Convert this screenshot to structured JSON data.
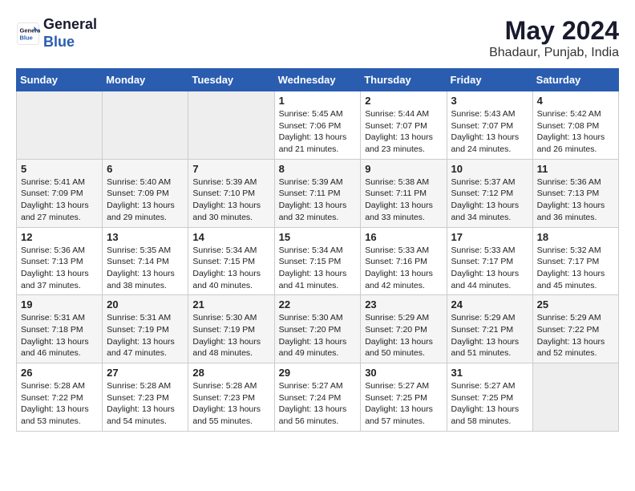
{
  "header": {
    "logo_line1": "General",
    "logo_line2": "Blue",
    "month": "May 2024",
    "location": "Bhadaur, Punjab, India"
  },
  "days_of_week": [
    "Sunday",
    "Monday",
    "Tuesday",
    "Wednesday",
    "Thursday",
    "Friday",
    "Saturday"
  ],
  "weeks": [
    [
      {
        "day": "",
        "info": ""
      },
      {
        "day": "",
        "info": ""
      },
      {
        "day": "",
        "info": ""
      },
      {
        "day": "1",
        "info": "Sunrise: 5:45 AM\nSunset: 7:06 PM\nDaylight: 13 hours\nand 21 minutes."
      },
      {
        "day": "2",
        "info": "Sunrise: 5:44 AM\nSunset: 7:07 PM\nDaylight: 13 hours\nand 23 minutes."
      },
      {
        "day": "3",
        "info": "Sunrise: 5:43 AM\nSunset: 7:07 PM\nDaylight: 13 hours\nand 24 minutes."
      },
      {
        "day": "4",
        "info": "Sunrise: 5:42 AM\nSunset: 7:08 PM\nDaylight: 13 hours\nand 26 minutes."
      }
    ],
    [
      {
        "day": "5",
        "info": "Sunrise: 5:41 AM\nSunset: 7:09 PM\nDaylight: 13 hours\nand 27 minutes."
      },
      {
        "day": "6",
        "info": "Sunrise: 5:40 AM\nSunset: 7:09 PM\nDaylight: 13 hours\nand 29 minutes."
      },
      {
        "day": "7",
        "info": "Sunrise: 5:39 AM\nSunset: 7:10 PM\nDaylight: 13 hours\nand 30 minutes."
      },
      {
        "day": "8",
        "info": "Sunrise: 5:39 AM\nSunset: 7:11 PM\nDaylight: 13 hours\nand 32 minutes."
      },
      {
        "day": "9",
        "info": "Sunrise: 5:38 AM\nSunset: 7:11 PM\nDaylight: 13 hours\nand 33 minutes."
      },
      {
        "day": "10",
        "info": "Sunrise: 5:37 AM\nSunset: 7:12 PM\nDaylight: 13 hours\nand 34 minutes."
      },
      {
        "day": "11",
        "info": "Sunrise: 5:36 AM\nSunset: 7:13 PM\nDaylight: 13 hours\nand 36 minutes."
      }
    ],
    [
      {
        "day": "12",
        "info": "Sunrise: 5:36 AM\nSunset: 7:13 PM\nDaylight: 13 hours\nand 37 minutes."
      },
      {
        "day": "13",
        "info": "Sunrise: 5:35 AM\nSunset: 7:14 PM\nDaylight: 13 hours\nand 38 minutes."
      },
      {
        "day": "14",
        "info": "Sunrise: 5:34 AM\nSunset: 7:15 PM\nDaylight: 13 hours\nand 40 minutes."
      },
      {
        "day": "15",
        "info": "Sunrise: 5:34 AM\nSunset: 7:15 PM\nDaylight: 13 hours\nand 41 minutes."
      },
      {
        "day": "16",
        "info": "Sunrise: 5:33 AM\nSunset: 7:16 PM\nDaylight: 13 hours\nand 42 minutes."
      },
      {
        "day": "17",
        "info": "Sunrise: 5:33 AM\nSunset: 7:17 PM\nDaylight: 13 hours\nand 44 minutes."
      },
      {
        "day": "18",
        "info": "Sunrise: 5:32 AM\nSunset: 7:17 PM\nDaylight: 13 hours\nand 45 minutes."
      }
    ],
    [
      {
        "day": "19",
        "info": "Sunrise: 5:31 AM\nSunset: 7:18 PM\nDaylight: 13 hours\nand 46 minutes."
      },
      {
        "day": "20",
        "info": "Sunrise: 5:31 AM\nSunset: 7:19 PM\nDaylight: 13 hours\nand 47 minutes."
      },
      {
        "day": "21",
        "info": "Sunrise: 5:30 AM\nSunset: 7:19 PM\nDaylight: 13 hours\nand 48 minutes."
      },
      {
        "day": "22",
        "info": "Sunrise: 5:30 AM\nSunset: 7:20 PM\nDaylight: 13 hours\nand 49 minutes."
      },
      {
        "day": "23",
        "info": "Sunrise: 5:29 AM\nSunset: 7:20 PM\nDaylight: 13 hours\nand 50 minutes."
      },
      {
        "day": "24",
        "info": "Sunrise: 5:29 AM\nSunset: 7:21 PM\nDaylight: 13 hours\nand 51 minutes."
      },
      {
        "day": "25",
        "info": "Sunrise: 5:29 AM\nSunset: 7:22 PM\nDaylight: 13 hours\nand 52 minutes."
      }
    ],
    [
      {
        "day": "26",
        "info": "Sunrise: 5:28 AM\nSunset: 7:22 PM\nDaylight: 13 hours\nand 53 minutes."
      },
      {
        "day": "27",
        "info": "Sunrise: 5:28 AM\nSunset: 7:23 PM\nDaylight: 13 hours\nand 54 minutes."
      },
      {
        "day": "28",
        "info": "Sunrise: 5:28 AM\nSunset: 7:23 PM\nDaylight: 13 hours\nand 55 minutes."
      },
      {
        "day": "29",
        "info": "Sunrise: 5:27 AM\nSunset: 7:24 PM\nDaylight: 13 hours\nand 56 minutes."
      },
      {
        "day": "30",
        "info": "Sunrise: 5:27 AM\nSunset: 7:25 PM\nDaylight: 13 hours\nand 57 minutes."
      },
      {
        "day": "31",
        "info": "Sunrise: 5:27 AM\nSunset: 7:25 PM\nDaylight: 13 hours\nand 58 minutes."
      },
      {
        "day": "",
        "info": ""
      }
    ]
  ]
}
